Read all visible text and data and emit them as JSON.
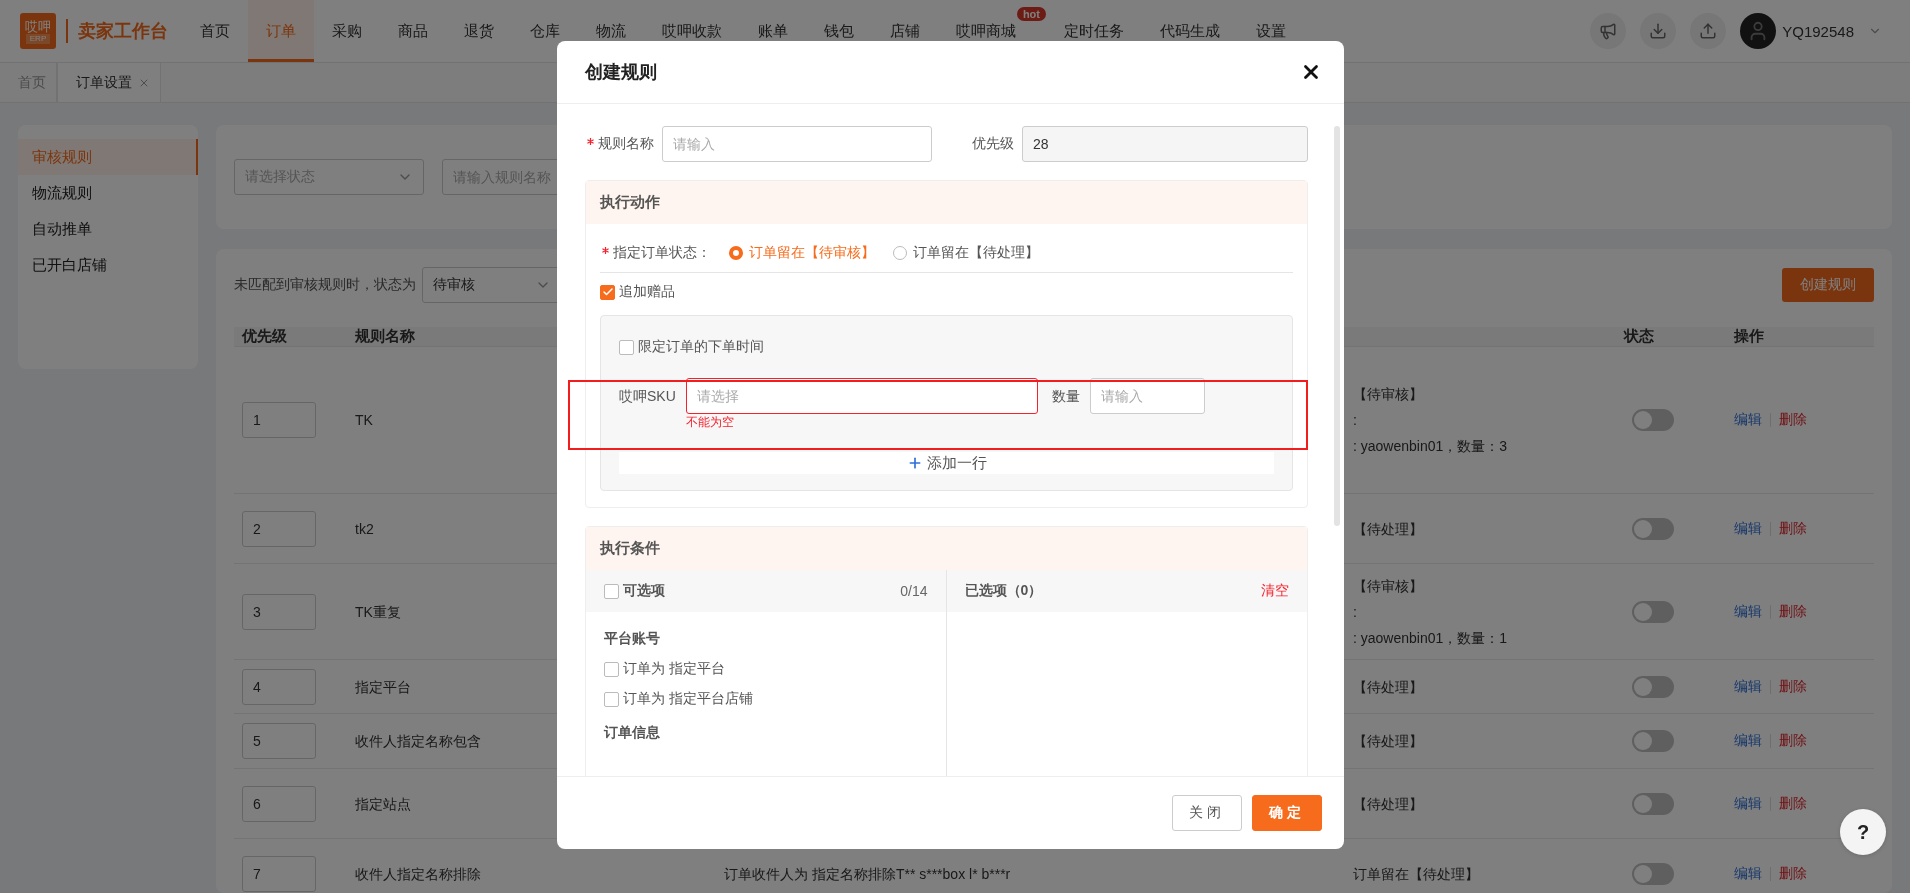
{
  "top_bar": {
    "logo": {
      "mark": "哎呷",
      "sub": "ERP"
    },
    "app_name": "卖家工作台",
    "nav": [
      {
        "label": "首页",
        "selected": false
      },
      {
        "label": "订单",
        "selected": true
      },
      {
        "label": "采购",
        "selected": false
      },
      {
        "label": "商品",
        "selected": false
      },
      {
        "label": "退货",
        "selected": false
      },
      {
        "label": "仓库",
        "selected": false
      },
      {
        "label": "物流",
        "selected": false
      },
      {
        "label": "哎呷收款",
        "selected": false
      },
      {
        "label": "账单",
        "selected": false
      },
      {
        "label": "钱包",
        "selected": false
      },
      {
        "label": "店铺",
        "selected": false
      },
      {
        "label": "哎呷商城",
        "selected": false,
        "badge": "hot"
      },
      {
        "label": "定时任务",
        "selected": false
      },
      {
        "label": "代码生成",
        "selected": false
      },
      {
        "label": "设置",
        "selected": false
      }
    ],
    "user": "YQ192548"
  },
  "tabs": [
    {
      "label": "首页",
      "selected": false,
      "closable": false
    },
    {
      "label": "订单设置",
      "selected": true,
      "closable": true
    }
  ],
  "sidebar": {
    "items": [
      {
        "label": "审核规则",
        "selected": true
      },
      {
        "label": "物流规则",
        "selected": false
      },
      {
        "label": "自动推单",
        "selected": false
      },
      {
        "label": "已开白店铺",
        "selected": false
      }
    ]
  },
  "filters": {
    "status_select": {
      "placeholder": "请选择状态"
    },
    "name_search": {
      "placeholder": "请输入规则名称"
    }
  },
  "rules_panel": {
    "default_status_label": "未匹配到审核规则时，状态为",
    "default_status": "待审核",
    "create_button": "创建规则",
    "columns": [
      {
        "label": "优先级"
      },
      {
        "label": "规则名称"
      },
      {
        "label": "状态"
      },
      {
        "label": "操作"
      }
    ],
    "rows": [
      {
        "priority": "1",
        "name": "TK",
        "action_lines": [
          "【待审核】",
          ":",
          ": yaowenbin01，数量：3"
        ],
        "on": false,
        "edit": "编辑",
        "delete": "删除"
      },
      {
        "priority": "2",
        "name": "tk2",
        "action_lines": [
          "【待处理】"
        ],
        "on": false,
        "edit": "编辑",
        "delete": "删除"
      },
      {
        "priority": "3",
        "name": "TK重复",
        "action_lines": [
          "【待审核】",
          ":",
          ": yaowenbin01，数量：1"
        ],
        "on": false,
        "edit": "编辑",
        "delete": "删除"
      },
      {
        "priority": "4",
        "name": "指定平台",
        "action_lines": [
          "【待处理】"
        ],
        "on": false,
        "edit": "编辑",
        "delete": "删除"
      },
      {
        "priority": "5",
        "name": "收件人指定名称包含",
        "action_lines": [
          "【待处理】"
        ],
        "on": false,
        "edit": "编辑",
        "delete": "删除"
      },
      {
        "priority": "6",
        "name": "指定站点",
        "action_lines": [
          "【待处理】"
        ],
        "on": false,
        "edit": "编辑",
        "delete": "删除"
      },
      {
        "priority": "7",
        "name": "收件人指定名称排除",
        "condition": "订单收件人为 指定名称排除T** s***box l* b***r",
        "action_lines": [
          "订单留在【待处理】"
        ],
        "on": false,
        "edit": "编辑",
        "delete": "删除"
      }
    ]
  },
  "modal": {
    "title": "创建规则",
    "rule_name": {
      "label": "规则名称",
      "required": true,
      "placeholder": "请输入"
    },
    "priority": {
      "label": "优先级",
      "value": "28",
      "disabled": true
    },
    "action_section": {
      "title": "执行动作",
      "status_label": "指定订单状态：",
      "status_required": true,
      "status_options": [
        {
          "label": "订单留在【待审核】",
          "selected": true
        },
        {
          "label": "订单留在【待处理】",
          "selected": false
        }
      ],
      "gift": {
        "label": "追加赠品",
        "checked": true
      },
      "time_limit": {
        "label": "限定订单的下单时间",
        "checked": false
      },
      "sku_rows": [
        {
          "sku_label": "哎呷SKU",
          "sku_placeholder": "请选择",
          "error": "不能为空",
          "qty_label": "数量",
          "qty_placeholder": "请输入"
        }
      ],
      "add_row": "添加一行"
    },
    "condition_section": {
      "title": "执行条件",
      "available": {
        "label": "可选项",
        "checked": false,
        "count": "0/14",
        "groups": [
          {
            "title": "平台账号",
            "options": [
              {
                "label": "订单为 指定平台",
                "checked": false
              },
              {
                "label": "订单为 指定平台店铺",
                "checked": false
              }
            ]
          },
          {
            "title": "订单信息"
          }
        ]
      },
      "chosen": {
        "label": "已选项（0）",
        "clear": "清空"
      }
    },
    "buttons": {
      "cancel": "关闭",
      "confirm": "确定"
    }
  },
  "help_button": "?"
}
